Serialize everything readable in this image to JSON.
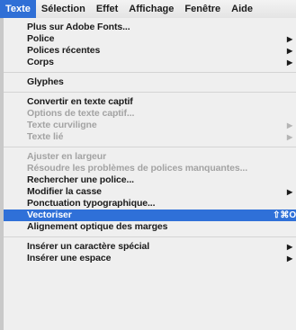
{
  "menubar": {
    "items": [
      "Texte",
      "Sélection",
      "Effet",
      "Affichage",
      "Fenêtre",
      "Aide"
    ]
  },
  "menu": {
    "group1": [
      "Plus sur Adobe Fonts...",
      "Police",
      "Polices récentes",
      "Corps"
    ],
    "group2": [
      "Glyphes"
    ],
    "group3": [
      "Convertir en texte captif",
      "Options de texte captif...",
      "Texte curviligne",
      "Texte lié"
    ],
    "group4": [
      "Ajuster en largeur",
      "Résoudre les problèmes de polices manquantes...",
      "Rechercher une police...",
      "Modifier la casse",
      "Ponctuation typographique...",
      "Vectoriser",
      "Alignement optique des marges"
    ],
    "group5": [
      "Insérer un caractère spécial",
      "Insérer une espace"
    ],
    "vectoriser_shortcut": "⇧⌘O",
    "highlight_color": "#2f70d8",
    "submenu_arrow": "▶"
  }
}
